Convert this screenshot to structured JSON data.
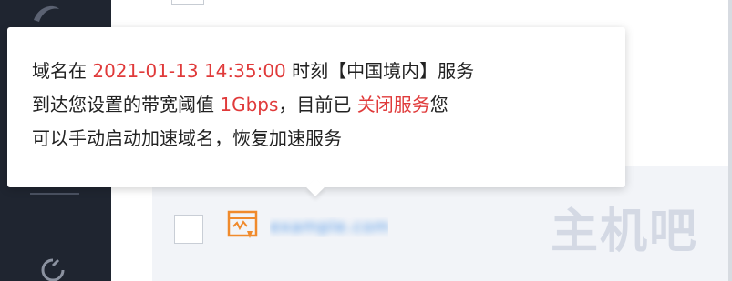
{
  "tooltip": {
    "line1_prefix": "域名在 ",
    "timestamp": "2021-01-13 14:35:00",
    "line1_suffix": " 时刻【中国境内】服务",
    "line2_prefix": "到达您设置的带宽阈值 ",
    "bandwidth": "1Gbps",
    "line2_middle": "，目前已 ",
    "status_action": "关闭服务",
    "line2_suffix": "您",
    "line3": "可以手动启动加速域名，恢复加速服务"
  },
  "table": {
    "domain_text": "example.com"
  },
  "watermark": {
    "text": "主机吧"
  },
  "colors": {
    "highlight": "#e03a3a",
    "sidebar_bg": "#1f2530",
    "link": "#1f7ae0",
    "icon_orange": "#f08a2c"
  },
  "icons": [
    "logo-icon",
    "nav-icon",
    "server-icon"
  ]
}
